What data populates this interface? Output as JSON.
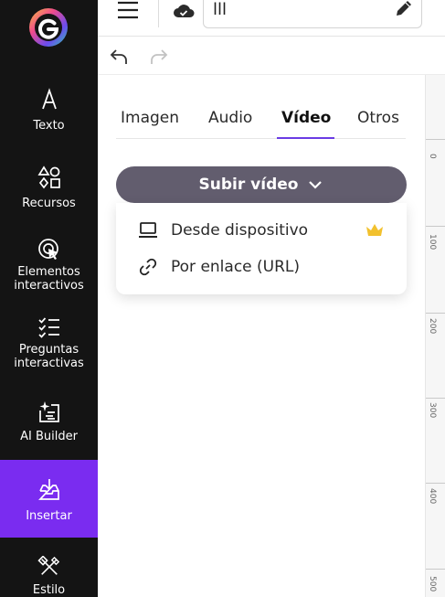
{
  "sidebar": {
    "items": [
      {
        "label": "Texto",
        "icon": "text-icon"
      },
      {
        "label": "Recursos",
        "icon": "shapes-icon"
      },
      {
        "label": "Elementos interactivos",
        "icon": "interactive-cursor-icon"
      },
      {
        "label": "Preguntas interactivas",
        "icon": "checklist-icon"
      },
      {
        "label": "AI Builder",
        "icon": "ai-sparkle-icon"
      },
      {
        "label": "Insertar",
        "icon": "insert-tray-icon"
      },
      {
        "label": "Estilo",
        "icon": "style-tools-icon"
      }
    ],
    "active_index": 5,
    "active_color": "#7a2cf0"
  },
  "header": {
    "title_value": "lll"
  },
  "panel": {
    "tabs": [
      {
        "label": "Imagen"
      },
      {
        "label": "Audio"
      },
      {
        "label": "Vídeo"
      },
      {
        "label": "Otros"
      }
    ],
    "active_tab": 2,
    "upload_button": {
      "label": "Subir vídeo"
    },
    "dropdown": [
      {
        "label": "Desde dispositivo",
        "icon": "laptop-icon",
        "premium": true
      },
      {
        "label": "Por enlace (URL)",
        "icon": "link-icon",
        "premium": false
      }
    ]
  },
  "ruler": {
    "labels": [
      "0",
      "100",
      "200",
      "300",
      "400",
      "500"
    ]
  },
  "colors": {
    "sidebar_bg": "#141414",
    "accent": "#6a3be4",
    "button_bg": "#625d6e",
    "crown": "#f2c12e"
  }
}
